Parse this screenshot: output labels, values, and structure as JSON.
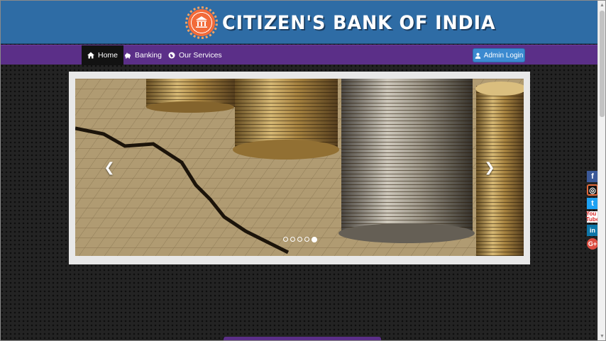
{
  "header": {
    "brand_title": "CITIZEN'S BANK OF INDIA",
    "logo_icon": "bank-building-icon",
    "background_color": "#2e6ca5"
  },
  "navbar": {
    "background_color": "#5b2f88",
    "items": [
      {
        "label": "Home",
        "icon": "home-icon",
        "active": true
      },
      {
        "label": "Banking",
        "icon": "piggy-bank-icon",
        "active": false
      },
      {
        "label": "Our Services",
        "icon": "globe-icon",
        "active": false
      }
    ],
    "admin_login_label": "Admin Login",
    "admin_login_icon": "user-icon"
  },
  "carousel": {
    "prev_icon": "chevron-left-icon",
    "next_icon": "chevron-right-icon",
    "slide_count": 5,
    "active_index": 4
  },
  "social": {
    "items": [
      {
        "name": "facebook",
        "glyph": "f"
      },
      {
        "name": "instagram",
        "glyph": "◎"
      },
      {
        "name": "twitter",
        "glyph": "t"
      },
      {
        "name": "youtube",
        "glyph": "You Tube"
      },
      {
        "name": "linkedin",
        "glyph": "in"
      },
      {
        "name": "google-plus",
        "glyph": "G+"
      }
    ]
  }
}
